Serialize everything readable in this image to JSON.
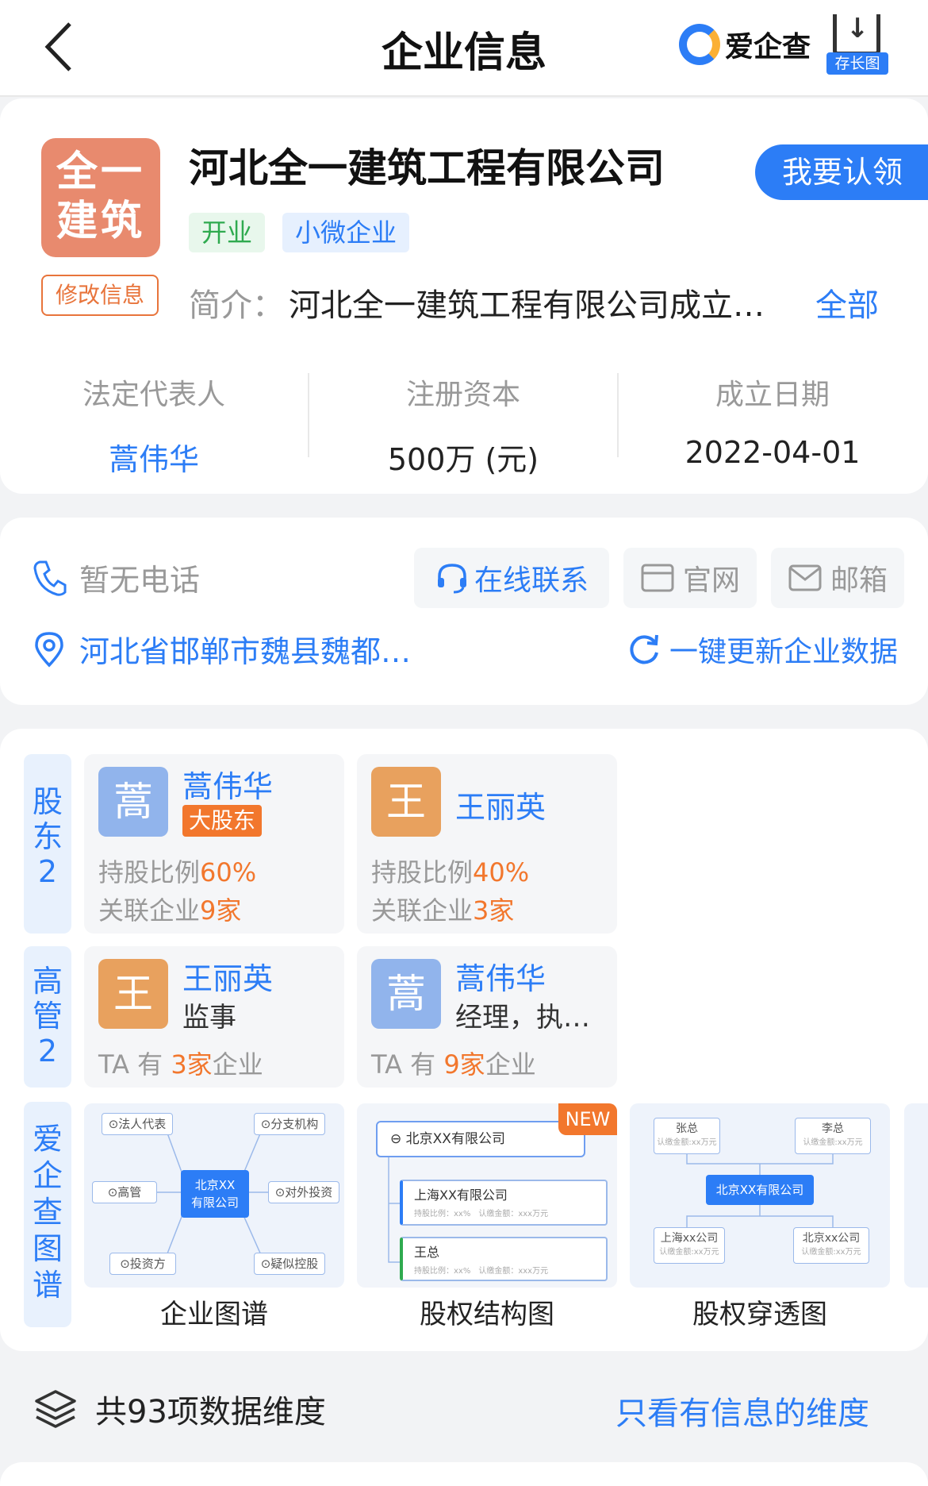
{
  "nav": {
    "title": "企业信息",
    "brand": "爱企查",
    "save_label": "存长图"
  },
  "company": {
    "logo_line1": "全一",
    "logo_line2": "建筑",
    "name": "河北全一建筑工程有限公司",
    "claim": "我要认领",
    "tags": [
      "开业",
      "小微企业"
    ],
    "edit": "修改信息",
    "intro_label": "简介：",
    "intro_text": "河北全一建筑工程有限公司成立…",
    "intro_all": "全部",
    "stats": [
      {
        "label": "法定代表人",
        "value": "蒿伟华"
      },
      {
        "label": "注册资本",
        "value": "500万 (元)"
      },
      {
        "label": "成立日期",
        "value": "2022-04-01"
      }
    ]
  },
  "contact": {
    "phone": "暂无电话",
    "online": "在线联系",
    "website": "官网",
    "email": "邮箱",
    "address": "河北省邯郸市魏县魏都…",
    "refresh": "一键更新企业数据"
  },
  "shareholders": {
    "side_line1": "股",
    "side_line2": "东",
    "side_count": "2",
    "items": [
      {
        "avatar": "蒿",
        "name": "蒿伟华",
        "badge": "大股东",
        "ratio_label": "持股比例",
        "ratio": "60%",
        "rel_label": "关联企业",
        "rel_count": "9",
        "rel_unit": "家"
      },
      {
        "avatar": "王",
        "name": "王丽英",
        "ratio_label": "持股比例",
        "ratio": "40%",
        "rel_label": "关联企业",
        "rel_count": "3",
        "rel_unit": "家"
      }
    ]
  },
  "executives": {
    "side_line1": "高",
    "side_line2": "管",
    "side_count": "2",
    "items": [
      {
        "avatar": "王",
        "name": "王丽英",
        "role": "监事",
        "ta_pre": "TA 有",
        "count": "3",
        "unit": "家",
        "suffix": "企业"
      },
      {
        "avatar": "蒿",
        "name": "蒿伟华",
        "role": "经理，执…",
        "ta_pre": "TA 有",
        "count": "9",
        "unit": "家",
        "suffix": "企业"
      }
    ]
  },
  "graphs": {
    "side_chars": [
      "爱",
      "企",
      "查",
      "图",
      "谱"
    ],
    "new_badge": "NEW",
    "items": [
      {
        "label": "企业图谱",
        "center_l1": "北京XX",
        "center_l2": "有限公司",
        "nodes": [
          "⊙法人代表",
          "⊙分支机构",
          "⊙高管",
          "⊙对外投资",
          "⊙投资方",
          "⊙疑似控股"
        ]
      },
      {
        "label": "股权结构图",
        "n1": "北京XX有限公司",
        "n2": "上海XX有限公司",
        "n2_sub": "持股比例：xx%　认缴金额：xxx万元",
        "n3": "王总",
        "n3_sub": "持股比例：xx%　认缴金额：xxx万元"
      },
      {
        "label": "股权穿透图",
        "top_left": "张总",
        "top_left_sub": "认缴金额:xx万元",
        "top_right": "李总",
        "top_right_sub": "认缴金额:xx万元",
        "center": "北京XX有限公司",
        "bot_left": "上海xx公司",
        "bot_left_sub": "认缴金额:xx万元",
        "bot_right": "北京xx公司",
        "bot_right_sub": "认缴金额:xx万元"
      }
    ]
  },
  "dimensions": {
    "total": "共93项数据维度",
    "filter": "只看有信息的维度"
  },
  "colors": {
    "accent": "#2c7df6",
    "orange": "#f2772d",
    "logo_bg": "#e88a6e"
  }
}
